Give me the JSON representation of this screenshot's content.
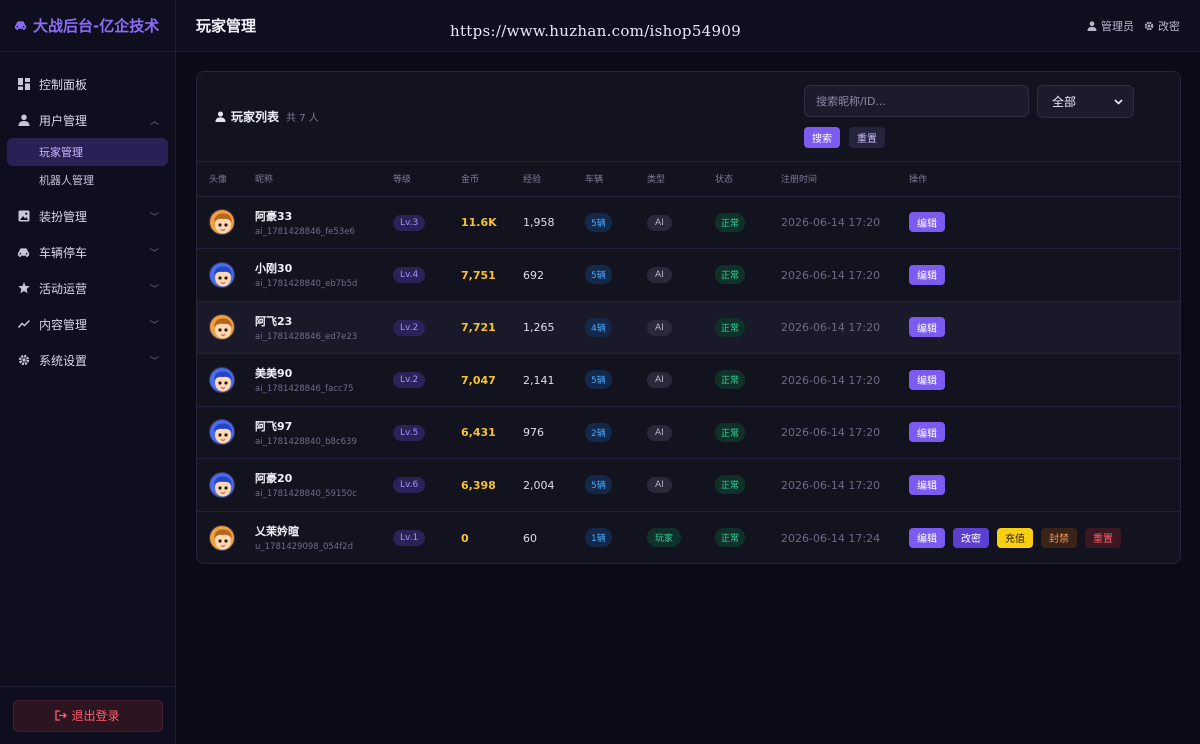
{
  "app": {
    "brand": "大战后台-亿企技术"
  },
  "sidebar": {
    "items": [
      {
        "label": "控制面板",
        "icon": "dashboard-icon"
      },
      {
        "label": "用户管理",
        "icon": "user-icon",
        "expanded": true,
        "children": [
          {
            "label": "玩家管理",
            "active": true
          },
          {
            "label": "机器人管理"
          }
        ]
      },
      {
        "label": "装扮管理",
        "icon": "image-icon"
      },
      {
        "label": "车辆停车",
        "icon": "car-icon"
      },
      {
        "label": "活动运营",
        "icon": "star-icon"
      },
      {
        "label": "内容管理",
        "icon": "trend-icon"
      },
      {
        "label": "系统设置",
        "icon": "gear-icon"
      }
    ],
    "logout": "退出登录"
  },
  "header": {
    "title": "玩家管理",
    "watermark": "https://www.huzhan.com/ishop54909",
    "admin": "管理员",
    "change_password": "改密"
  },
  "list": {
    "title": "玩家列表",
    "count": "共 7 人",
    "search_placeholder": "搜索昵称/ID...",
    "filter_value": "全部",
    "search_btn": "搜索",
    "reset_btn": "重置",
    "columns": [
      "头像",
      "昵称",
      "等级",
      "金币",
      "经验",
      "车辆",
      "类型",
      "状态",
      "注册时间",
      "操作"
    ],
    "rows": [
      {
        "avatar": "orange",
        "nick": "阿豪33",
        "uid": "ai_1781428846_fe53e6",
        "level": "Lv.3",
        "coins": "11.6K",
        "exp": "1,958",
        "vehicles": "5辆",
        "type": "AI",
        "status": "正常",
        "time": "2026-06-14 17:20",
        "actions": [
          "编辑"
        ]
      },
      {
        "avatar": "blue",
        "nick": "小刚30",
        "uid": "ai_1781428840_eb7b5d",
        "level": "Lv.4",
        "coins": "7,751",
        "exp": "692",
        "vehicles": "5辆",
        "type": "AI",
        "status": "正常",
        "time": "2026-06-14 17:20",
        "actions": [
          "编辑"
        ]
      },
      {
        "avatar": "orange",
        "nick": "阿飞23",
        "uid": "ai_1781428846_ed7e23",
        "level": "Lv.2",
        "coins": "7,721",
        "exp": "1,265",
        "vehicles": "4辆",
        "type": "AI",
        "status": "正常",
        "time": "2026-06-14 17:20",
        "actions": [
          "编辑"
        ]
      },
      {
        "avatar": "blue",
        "nick": "美美90",
        "uid": "ai_1781428846_facc75",
        "level": "Lv.2",
        "coins": "7,047",
        "exp": "2,141",
        "vehicles": "5辆",
        "type": "AI",
        "status": "正常",
        "time": "2026-06-14 17:20",
        "actions": [
          "编辑"
        ]
      },
      {
        "avatar": "blue",
        "nick": "阿飞97",
        "uid": "ai_1781428840_b8c639",
        "level": "Lv.5",
        "coins": "6,431",
        "exp": "976",
        "vehicles": "2辆",
        "type": "AI",
        "status": "正常",
        "time": "2026-06-14 17:20",
        "actions": [
          "编辑"
        ]
      },
      {
        "avatar": "blue",
        "nick": "阿豪20",
        "uid": "ai_1781428840_59150c",
        "level": "Lv.6",
        "coins": "6,398",
        "exp": "2,004",
        "vehicles": "5辆",
        "type": "AI",
        "status": "正常",
        "time": "2026-06-14 17:20",
        "actions": [
          "编辑"
        ]
      },
      {
        "avatar": "orange",
        "nick": "乂茉妗暄",
        "uid": "u_1781429098_054f2d",
        "level": "Lv.1",
        "coins": "0",
        "exp": "60",
        "vehicles": "1辆",
        "type": "玩家",
        "status": "正常",
        "time": "2026-06-14 17:24",
        "actions": [
          "编辑",
          "改密",
          "充值",
          "封禁",
          "重置"
        ]
      }
    ]
  },
  "colors": {
    "accent": "#7c5cf0",
    "coins": "#f7c232",
    "ok": "#34d399",
    "danger": "#ff5d6c"
  }
}
